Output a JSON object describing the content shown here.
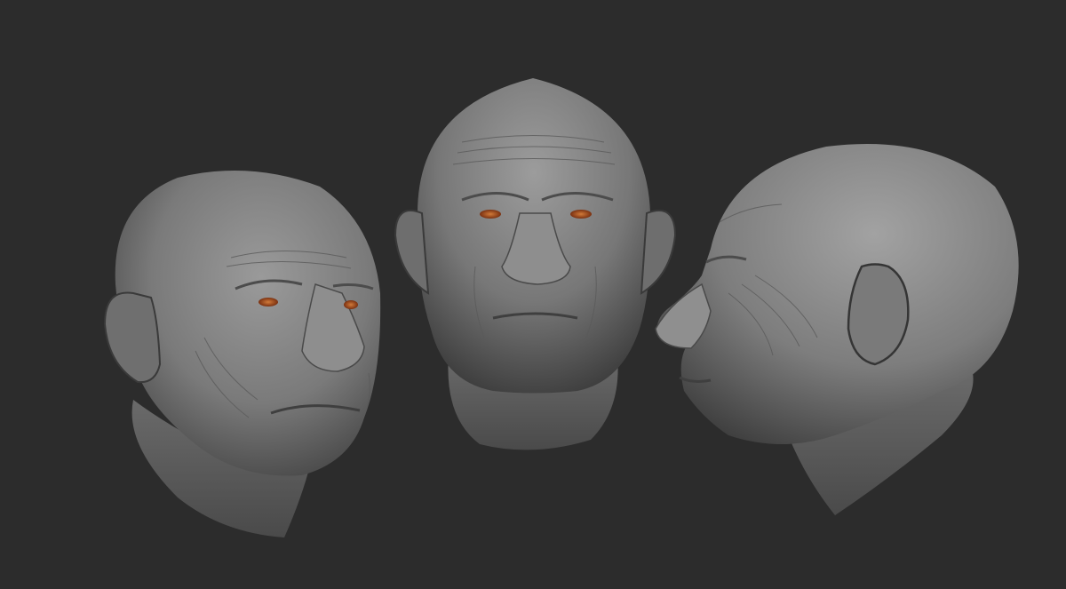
{
  "scene": {
    "background_color": "#2c2c2c",
    "sculpt_material_color": "#8a8a8a",
    "eye_color": "#b5561e",
    "views": [
      {
        "view": "three-quarter-left"
      },
      {
        "view": "front"
      },
      {
        "view": "profile-left"
      }
    ]
  }
}
